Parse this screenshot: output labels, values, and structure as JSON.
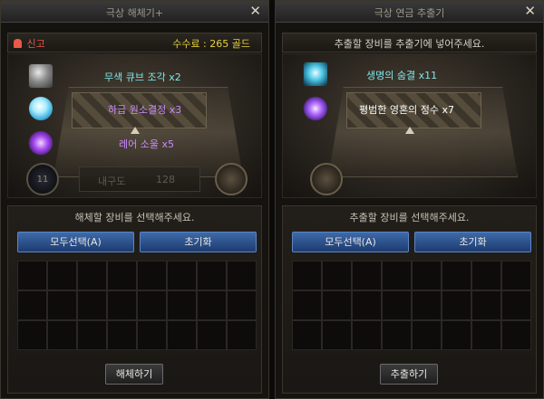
{
  "left": {
    "title": "극상 해체기+",
    "report_label": "신고",
    "fee_text": "수수료 : 265 골드",
    "items": [
      {
        "name": "무색 큐브 조각",
        "qty": "x2",
        "icon": "cube-fragment-icon",
        "color": "#7fe6ea"
      },
      {
        "name": "하급 원소결정",
        "qty": "x3",
        "icon": "element-crystal-icon",
        "color": "#c88cff"
      },
      {
        "name": "레어 소울",
        "qty": "x5",
        "icon": "rare-soul-icon",
        "color": "#c88cff"
      }
    ],
    "dial_value": "11",
    "durability_label": "내구도",
    "durability_value": "128",
    "instruction": "해체할 장비를 선택해주세요.",
    "select_all_label": "모두선택(A)",
    "reset_label": "초기화",
    "action_label": "해체하기"
  },
  "right": {
    "title": "극상 연금 추출기",
    "header_text": "추출할 장비를 추출기에 넣어주세요.",
    "items": [
      {
        "name": "생명의 숨결",
        "qty": "x11",
        "icon": "breath-of-life-icon",
        "color": "#7fe6ea"
      },
      {
        "name": "평범한 영혼의 정수",
        "qty": "x7",
        "icon": "soul-essence-icon",
        "color": "#ffffff"
      }
    ],
    "instruction": "추출할 장비를 선택해주세요.",
    "select_all_label": "모두선택(A)",
    "reset_label": "초기화",
    "action_label": "추출하기"
  },
  "colors": {
    "fee": "#e6d23a",
    "report": "#e85a48",
    "accent_blue": "#3e6aa8"
  }
}
